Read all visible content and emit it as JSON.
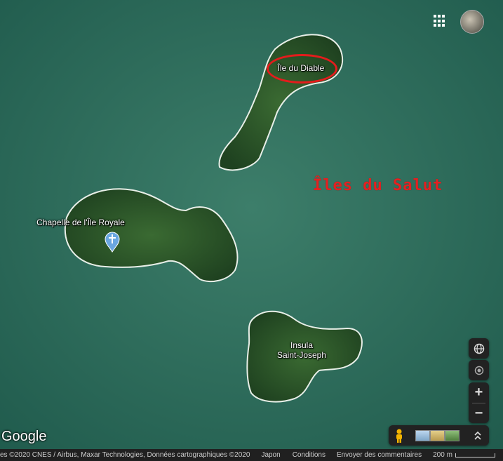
{
  "map": {
    "places": {
      "devil_island": "Île du Diable",
      "chapel": "Chapelle de l'Île Royale",
      "saint_joseph": "Insula\nSaint-Joseph"
    },
    "archipelago_label": "Îles du Salut"
  },
  "branding": {
    "logo": "Google"
  },
  "footer": {
    "attribution": "es ©2020 CNES / Airbus, Maxar Technologies, Données cartographiques ©2020",
    "country": "Japon",
    "terms": "Conditions",
    "feedback": "Envoyer des commentaires",
    "scale": "200 m"
  },
  "controls": {
    "zoom_in": "+",
    "zoom_out": "−"
  },
  "colors": {
    "sea": "#2f6f60",
    "land": "#2f5a2c",
    "annotation": "#e41c1c"
  },
  "icons": [
    "apps-grid-icon",
    "globe-icon",
    "locate-icon",
    "pegman-icon",
    "chevron-up-icon",
    "church-pin-icon"
  ]
}
